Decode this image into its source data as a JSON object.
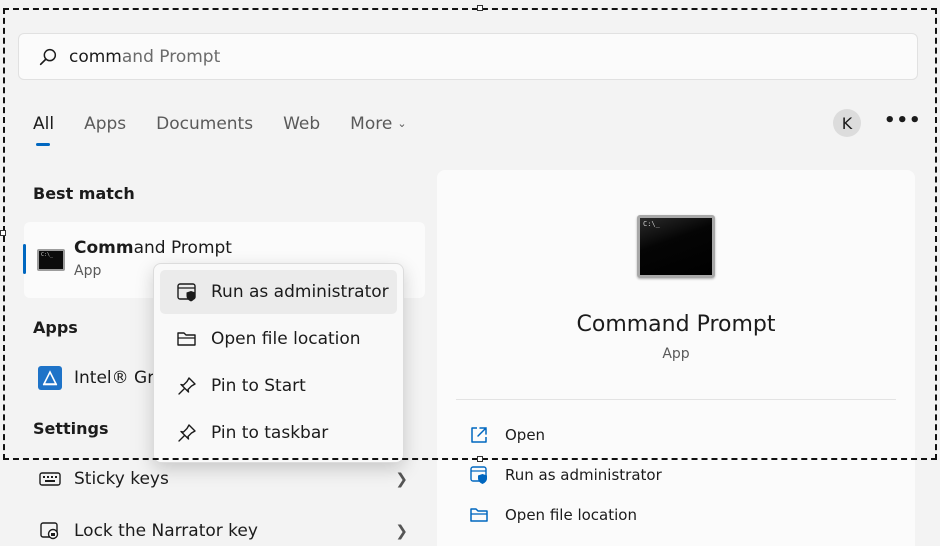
{
  "search": {
    "typed": "comm",
    "suggested": "and Prompt",
    "icon": "search-icon"
  },
  "tabs": [
    {
      "label": "All",
      "active": true
    },
    {
      "label": "Apps",
      "active": false
    },
    {
      "label": "Documents",
      "active": false
    },
    {
      "label": "Web",
      "active": false
    },
    {
      "label": "More",
      "active": false
    }
  ],
  "account": {
    "avatar_letter": "K"
  },
  "more_options": "•••",
  "sections": {
    "best_match": "Best match",
    "apps": "Apps",
    "settings": "Settings"
  },
  "best_match": {
    "name_typed": "Comm",
    "name_rest": "and Prompt",
    "subtitle": "App",
    "icon_text": "C:\\_"
  },
  "apps": [
    {
      "name": "Intel® Gra",
      "icon": "intel-graphics-icon"
    }
  ],
  "settings": [
    {
      "label": "Sticky keys",
      "icon": "keyboard-icon"
    },
    {
      "label": "Lock the Narrator key",
      "icon": "narrator-icon"
    }
  ],
  "context_menu": {
    "items": [
      {
        "label": "Run as administrator",
        "icon": "shield-icon"
      },
      {
        "label": "Open file location",
        "icon": "folder-icon"
      },
      {
        "label": "Pin to Start",
        "icon": "pin-icon"
      },
      {
        "label": "Pin to taskbar",
        "icon": "pin-icon"
      }
    ]
  },
  "preview": {
    "title": "Command Prompt",
    "subtitle": "App",
    "icon_text": "C:\\_",
    "actions": [
      {
        "label": "Open",
        "icon": "open-external-icon"
      },
      {
        "label": "Run as administrator",
        "icon": "shield-icon"
      },
      {
        "label": "Open file location",
        "icon": "folder-icon"
      }
    ]
  },
  "colors": {
    "accent": "#0067c0",
    "background": "#f3f3f3",
    "panel": "#fbfbfb"
  }
}
